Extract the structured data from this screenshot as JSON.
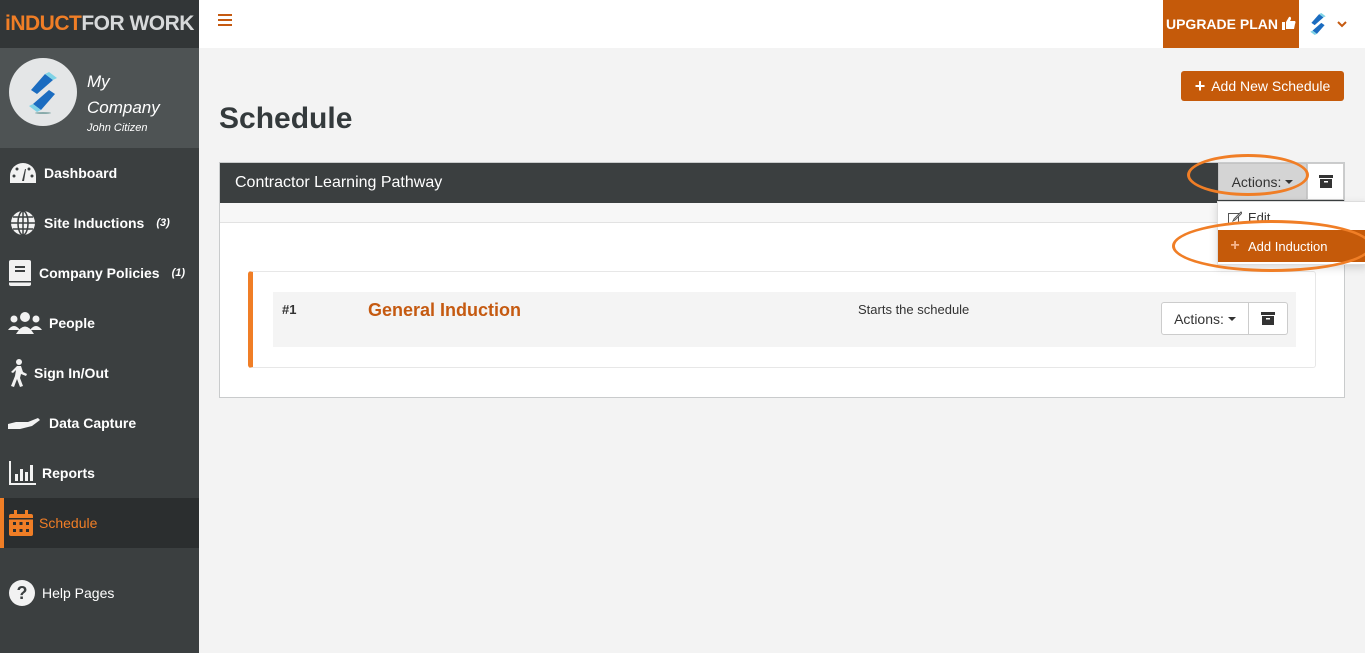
{
  "brand": {
    "logo_part1": "iNDUCT",
    "logo_part2": "FOR WORK",
    "accent": "#f07e26",
    "primary": "#c55a0a"
  },
  "profile": {
    "company_line1": "My",
    "company_line2": "Company",
    "user_name": "John Citizen"
  },
  "sidebar": {
    "items": [
      {
        "label": "Dashboard",
        "icon": "dashboard-gauge-icon",
        "count": ""
      },
      {
        "label": "Site Inductions",
        "icon": "globe-icon",
        "count": "(3)"
      },
      {
        "label": "Company Policies",
        "icon": "book-icon",
        "count": "(1)"
      },
      {
        "label": "People",
        "icon": "users-icon",
        "count": ""
      },
      {
        "label": "Sign In/Out",
        "icon": "walking-person-icon",
        "count": ""
      },
      {
        "label": "Data Capture",
        "icon": "hand-icon",
        "count": ""
      },
      {
        "label": "Reports",
        "icon": "bar-chart-icon",
        "count": ""
      },
      {
        "label": "Schedule",
        "icon": "calendar-icon",
        "count": "",
        "active": true
      },
      {
        "label": "Help Pages",
        "icon": "question-circle-icon",
        "count": ""
      }
    ]
  },
  "topbar": {
    "menu_icon": "hamburger-icon",
    "upgrade_label": "UPGRADE PLAN",
    "upgrade_icon": "thumbs-up-icon",
    "user_menu_icon": "chevron-down-icon"
  },
  "main": {
    "page_title": "Schedule",
    "add_schedule_label": "Add New Schedule",
    "schedule": {
      "name": "Contractor Learning Pathway",
      "actions_label": "Actions:",
      "dropdown": [
        {
          "label": "Edit",
          "icon": "edit-icon"
        },
        {
          "label": "Add Induction",
          "icon": "plus-icon",
          "highlighted": true
        }
      ],
      "steps": [
        {
          "number": "#1",
          "title": "General Induction",
          "description": "Starts the schedule",
          "actions_label": "Actions:"
        }
      ]
    }
  }
}
